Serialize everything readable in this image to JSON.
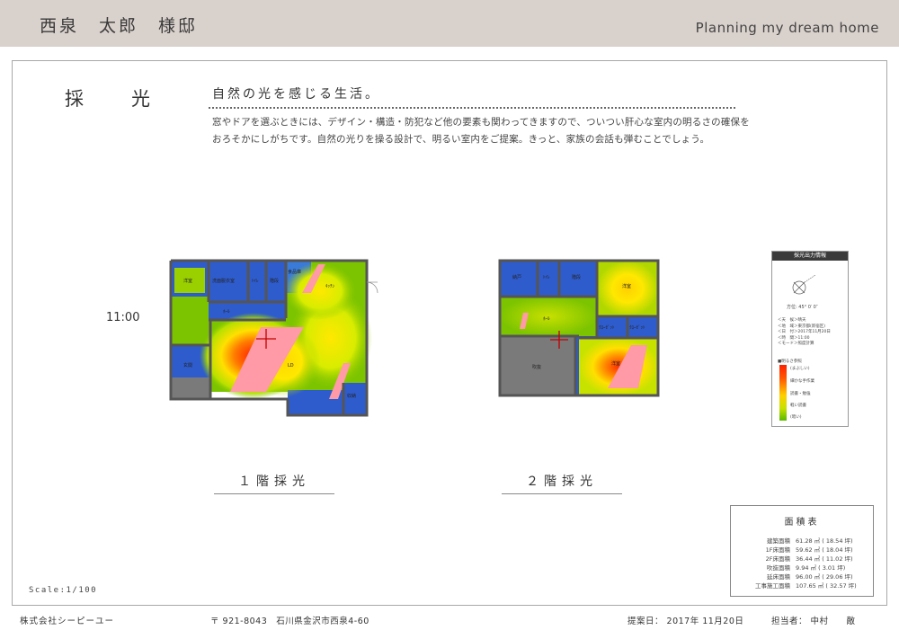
{
  "header": {
    "owner": "西泉　太郎　様邸",
    "tagline": "Planning my dream home"
  },
  "section": {
    "title": "採　光",
    "subtitle": "自然の光を感じる生活。",
    "description": "窓やドアを選ぶときには、デザイン・構造・防犯など他の要素も関わってきますので、ついつい肝心な室内の明るさの確保をおろそかにしがちです。自然の光りを操る設計で、明るい室内をご提案。きっと、家族の会話も弾むことでしょう。"
  },
  "time_label": "11:00",
  "floor1": {
    "label": "１階採光",
    "rooms": {
      "youshitsu": "洋室",
      "senmen": "洗面脱衣室",
      "toilet": "ﾄｲﾚ",
      "stairs": "階段",
      "pantry": "食品庫",
      "hall": "ﾎｰﾙ",
      "kitchen": "ｷｯﾁﾝ",
      "ldk": "LD",
      "genkan": "玄関",
      "storage": "収納"
    }
  },
  "floor2": {
    "label": "２階採光",
    "rooms": {
      "nando": "納戸",
      "toilet": "ﾄｲﾚ",
      "stairs": "階段",
      "youshitsu1": "洋室",
      "hall": "ﾎｰﾙ",
      "closet1": "ｸﾛｰｾﾞｯﾄ",
      "closet2": "ｸﾛｰｾﾞｯﾄ",
      "fukinuke": "吹抜",
      "youshitsu2": "洋室"
    }
  },
  "info": {
    "title": "採光出力情報",
    "angle": "方位: 45° 0′ 0″",
    "lines": [
      "＜天　候＞晴天",
      "＜地　域＞東京都(新宿区)",
      "＜日　付＞2017年11月20日",
      "＜時　間＞11:00",
      "＜モード＞照度計算"
    ],
    "legend_title": "■明るさ参照",
    "legend": [
      "(まぶしい)",
      "細かな手作業",
      "読書・勉強",
      "軽い読書",
      "(暗い)"
    ]
  },
  "area": {
    "title": "面積表",
    "rows": [
      {
        "label": "建築面積",
        "value": "61.28 ㎡ ( 18.54 坪)"
      },
      {
        "label": "1F床面積",
        "value": "59.62 ㎡ ( 18.04 坪)"
      },
      {
        "label": "2F床面積",
        "value": "36.44 ㎡ ( 11.02 坪)"
      },
      {
        "label": "吹抜面積",
        "value": "9.94 ㎡ ( 3.01 坪)"
      },
      {
        "label": "延床面積",
        "value": "96.00 ㎡ ( 29.06 坪)"
      },
      {
        "label": "工事施工面積",
        "value": "107.65 ㎡ ( 32.57 坪)"
      }
    ]
  },
  "scale": "Scale:1/100",
  "footer": {
    "company": "株式会社シーピーユー",
    "address": "〒 921-8043　石川県金沢市西泉4-60",
    "date": "提案日：  2017年  11月20日",
    "person": "担当者：  中村　　敵"
  },
  "colors": {
    "header_bg": "#d9d1cc",
    "wall": "#555555",
    "room_blue": "#2f5ccc",
    "bright_red": "#ff2a1a",
    "light_yellow": "#ffe000",
    "light_green": "#78c000",
    "window_pink": "#ff9aa6"
  }
}
